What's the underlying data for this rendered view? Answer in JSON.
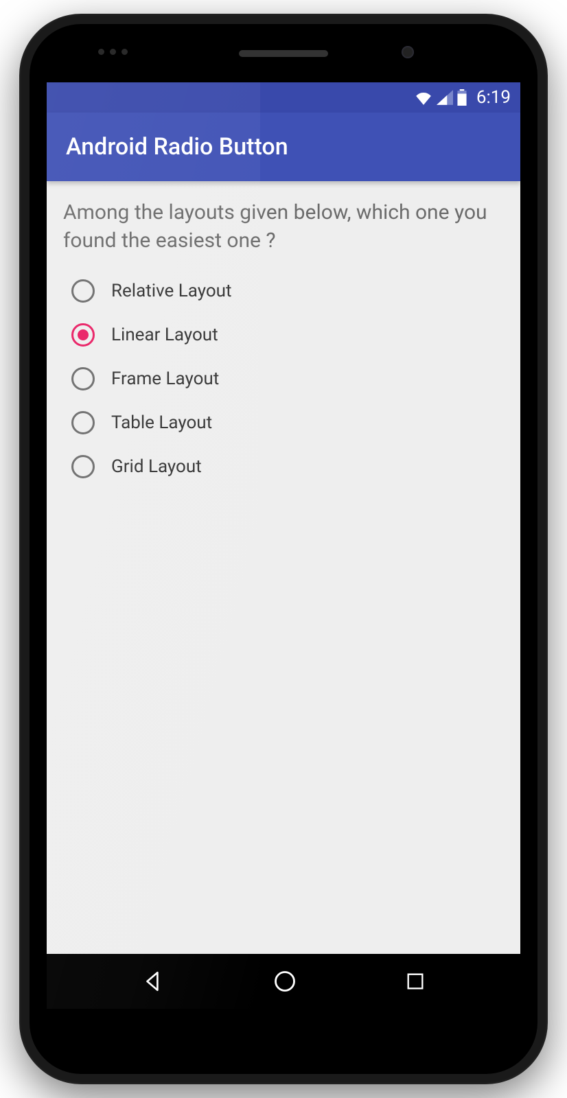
{
  "statusBar": {
    "time": "6:19"
  },
  "appBar": {
    "title": "Android Radio Button"
  },
  "content": {
    "question": "Among the layouts given below, which one you found the easiest one ?"
  },
  "radioOptions": [
    {
      "label": "Relative Layout",
      "selected": false
    },
    {
      "label": "Linear Layout",
      "selected": true
    },
    {
      "label": "Frame Layout",
      "selected": false
    },
    {
      "label": "Table Layout",
      "selected": false
    },
    {
      "label": "Grid Layout",
      "selected": false
    }
  ],
  "colors": {
    "primary": "#3f51b5",
    "primaryDark": "#3949ab",
    "accent": "#e91e63",
    "background": "#eeeeee"
  }
}
